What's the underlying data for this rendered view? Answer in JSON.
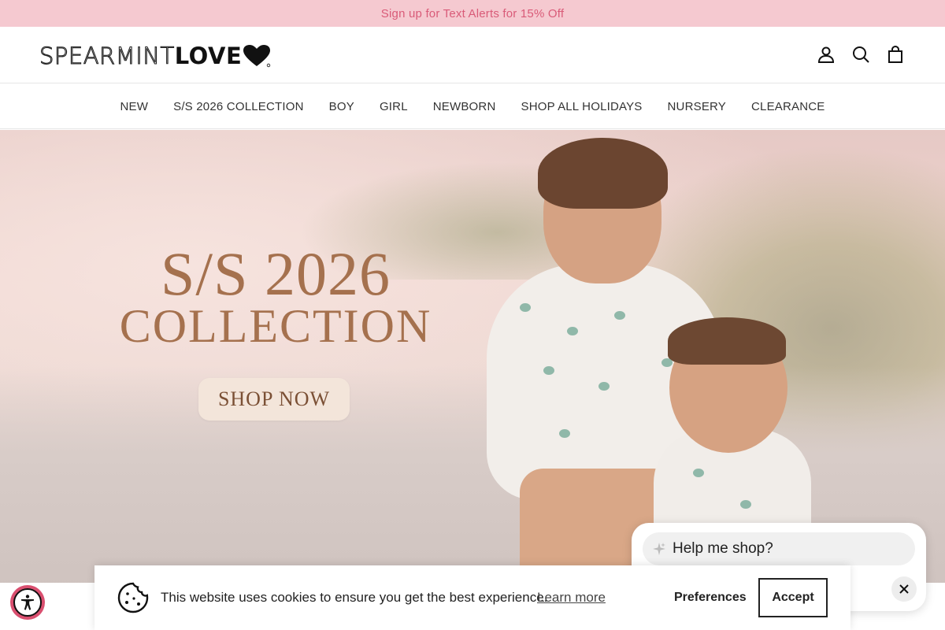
{
  "announcement": {
    "text": "Sign up for Text Alerts for 15% Off"
  },
  "header": {
    "logo_light": "SPEARMINT",
    "logo_bold": "LOVE",
    "icons": [
      "account-icon",
      "search-icon",
      "cart-icon"
    ]
  },
  "nav": {
    "items": [
      {
        "label": "NEW"
      },
      {
        "label": "S/S 2026 COLLECTION"
      },
      {
        "label": "BOY"
      },
      {
        "label": "GIRL"
      },
      {
        "label": "NEWBORN"
      },
      {
        "label": "SHOP ALL HOLIDAYS"
      },
      {
        "label": "NURSERY"
      },
      {
        "label": "CLEARANCE"
      }
    ]
  },
  "hero": {
    "title_line1": "S/S 2026",
    "title_line2": "COLLECTION",
    "cta_label": "SHOP NOW"
  },
  "chat": {
    "prompt": "Help me shop?"
  },
  "cookie": {
    "message": "This website uses cookies to ensure you get the best experience.",
    "learn_more": "Learn more",
    "preferences": "Preferences",
    "accept": "Accept"
  },
  "colors": {
    "announcement_bg": "#f5c9d0",
    "announcement_text": "#d95b78",
    "hero_title": "#a5714e",
    "accessibility_button": "#d94f6f"
  }
}
